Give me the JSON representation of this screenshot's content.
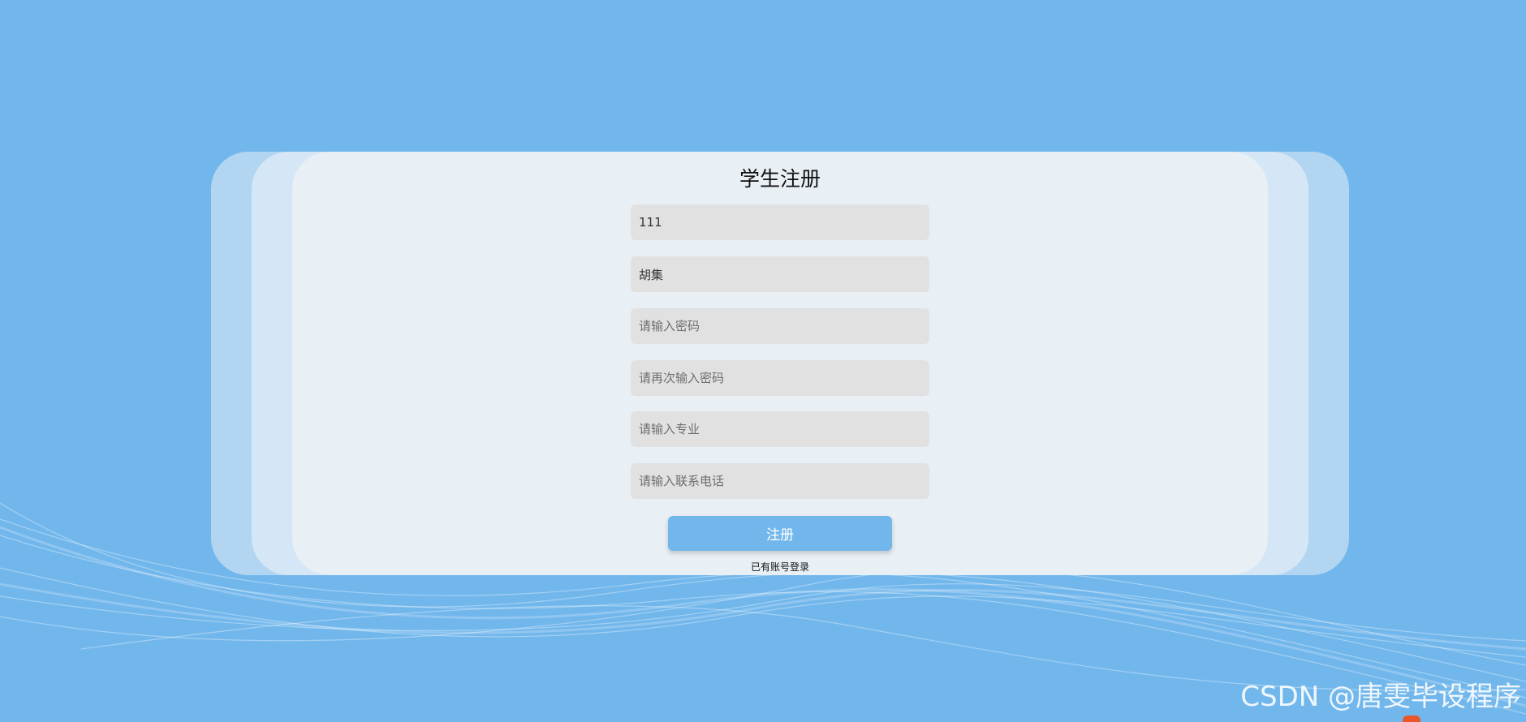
{
  "form": {
    "title": "学生注册",
    "fields": [
      {
        "value": "111",
        "placeholder": ""
      },
      {
        "value": "胡集",
        "placeholder": ""
      },
      {
        "value": "",
        "placeholder": "请输入密码"
      },
      {
        "value": "",
        "placeholder": "请再次输入密码"
      },
      {
        "value": "",
        "placeholder": "请输入专业"
      },
      {
        "value": "",
        "placeholder": "请输入联系电话"
      }
    ],
    "submit_label": "注册",
    "login_link": "已有账号登录"
  },
  "watermark": "CSDN @唐雯毕设程序",
  "colors": {
    "background": "#72b7ec",
    "card": "#e8eff5",
    "input": "#e1e1e1",
    "button": "#72b7ec"
  }
}
